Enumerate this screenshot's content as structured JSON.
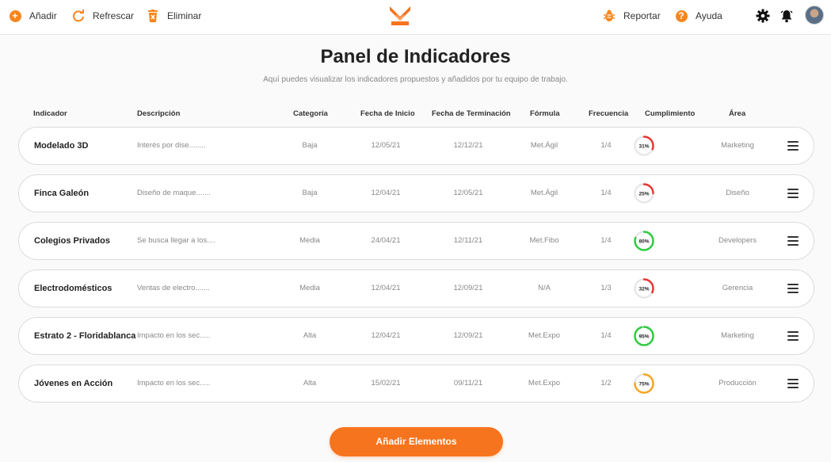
{
  "toolbar": {
    "add_label": "Añadir",
    "refresh_label": "Refrescar",
    "delete_label": "Eliminar",
    "report_label": "Reportar",
    "help_label": "Ayuda"
  },
  "page": {
    "title": "Panel de Indicadores",
    "subtitle": "Aquí puedes visualizar los indicadores propuestos y añadidos por tu equipo de trabajo."
  },
  "table": {
    "headers": [
      "Indicador",
      "Descripción",
      "Categoría",
      "Fecha de Inicio",
      "Fecha de Terminación",
      "Fórmula",
      "Frecuencia",
      "Cumplimiento",
      "Área"
    ],
    "rows": [
      {
        "name": "Modelado 3D",
        "description": "Interés por dise........",
        "category": "Baja",
        "start": "12/05/21",
        "end": "12/12/21",
        "formula": "Met.Ágil",
        "frequency": "1/4",
        "compliance": 31,
        "compliance_label": "31%",
        "area": "Marketing"
      },
      {
        "name": "Finca Galeón",
        "description": "Diseño de maque.......",
        "category": "Baja",
        "start": "12/04/21",
        "end": "12/05/21",
        "formula": "Met.Ágil",
        "frequency": "1/4",
        "compliance": 25,
        "compliance_label": "25%",
        "area": "Diseño"
      },
      {
        "name": "Colegios Privados",
        "description": "Se busca llegar a los....",
        "category": "Media",
        "start": "24/04/21",
        "end": "12/11/21",
        "formula": "Met.Fibo",
        "frequency": "1/4",
        "compliance": 80,
        "compliance_label": "80%",
        "area": "Developers"
      },
      {
        "name": "Electrodomésticos",
        "description": "Ventas de electro.......",
        "category": "Media",
        "start": "12/04/21",
        "end": "12/09/21",
        "formula": "N/A",
        "frequency": "1/3",
        "compliance": 32,
        "compliance_label": "32%",
        "area": "Gerencia"
      },
      {
        "name": "Estrato 2 - Floridablanca",
        "description": "Impacto en los sec.....",
        "category": "Alta",
        "start": "12/04/21",
        "end": "12/09/21",
        "formula": "Met.Expo",
        "frequency": "1/4",
        "compliance": 95,
        "compliance_label": "95%",
        "area": "Marketing"
      },
      {
        "name": "Jóvenes en Acción",
        "description": "Impacto en los sec.....",
        "category": "Alta",
        "start": "15/02/21",
        "end": "09/11/21",
        "formula": "Met.Expo",
        "frequency": "1/2",
        "compliance": 75,
        "compliance_label": "75%",
        "area": "Producción"
      }
    ]
  },
  "cta": {
    "label": "Añadir Elementos"
  },
  "colors": {
    "accent": "#f7741e",
    "low": "#e53935",
    "mid": "#f5a623",
    "high": "#2ecc40"
  }
}
